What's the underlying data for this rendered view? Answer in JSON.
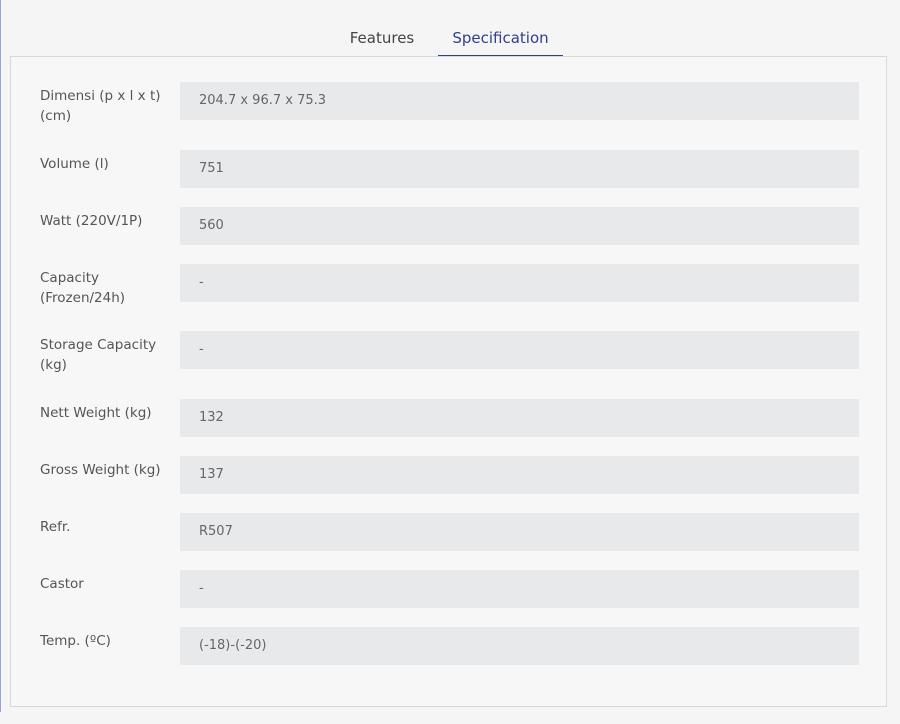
{
  "tabs": {
    "features": "Features",
    "specification": "Specification"
  },
  "specs": [
    {
      "label": "Dimensi (p x l x t) (cm)",
      "value": "204.7 x 96.7 x 75.3"
    },
    {
      "label": "Volume (l)",
      "value": "751"
    },
    {
      "label": "Watt (220V/1P)",
      "value": "560"
    },
    {
      "label": "Capacity (Frozen/24h)",
      "value": "-"
    },
    {
      "label": "Storage Capacity (kg)",
      "value": "-"
    },
    {
      "label": "Nett Weight (kg)",
      "value": "132"
    },
    {
      "label": "Gross Weight (kg)",
      "value": "137"
    },
    {
      "label": "Refr.",
      "value": "R507"
    },
    {
      "label": "Castor",
      "value": "-"
    },
    {
      "label": "Temp. (ºC)",
      "value": "(-18)-(-20)"
    }
  ]
}
